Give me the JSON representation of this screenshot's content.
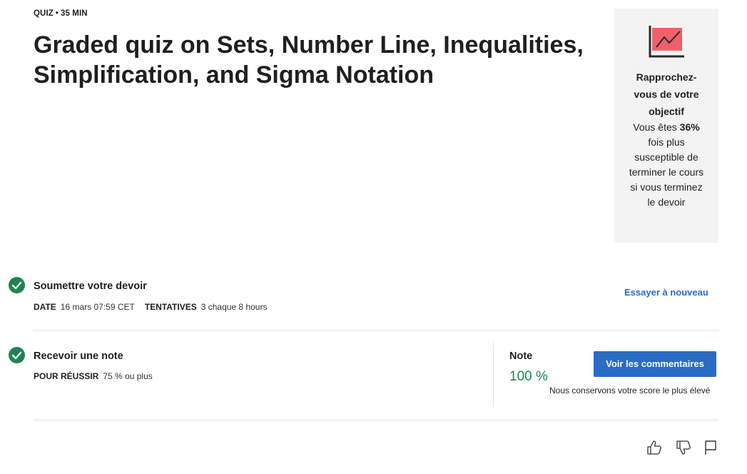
{
  "header": {
    "type": "QUIZ",
    "separator": "•",
    "duration": "35  MIN",
    "title": "Graded quiz on Sets, Number Line, Inequalities, Simplification, and Sigma Notation"
  },
  "goal_card": {
    "icon": "line-chart-icon",
    "heading": "Rapprochez-vous de votre objectif",
    "text_before": "Vous êtes ",
    "highlight": "36%",
    "text_after": " fois plus susceptible de terminer le cours si vous terminez le devoir",
    "accent_color": "#f0606a"
  },
  "submit_section": {
    "icon": "check-circle-icon",
    "title": "Soumettre votre devoir",
    "date_label": "DATE",
    "date_value": "16 mars 07:59 CET",
    "attempts_label": "TENTATIVES",
    "attempts_value": "3 chaque 8  hours",
    "retry_link": "Essayer à nouveau"
  },
  "grade_section": {
    "icon": "check-circle-icon",
    "title": "Recevoir une note",
    "pass_label": "POUR RÉUSSIR",
    "pass_value": "75 % ou plus",
    "note_label": "Note",
    "note_value": "100 %",
    "feedback_button": "Voir les commentaires",
    "note_sub": "Nous conservons votre score le plus élevé"
  },
  "feedback": {
    "like_icon": "thumbs-up-icon",
    "dislike_icon": "thumbs-down-icon",
    "flag_icon": "flag-icon"
  },
  "colors": {
    "primary": "#2a6bc4",
    "success": "#1f8354",
    "card_bg": "#f3f3f3"
  }
}
